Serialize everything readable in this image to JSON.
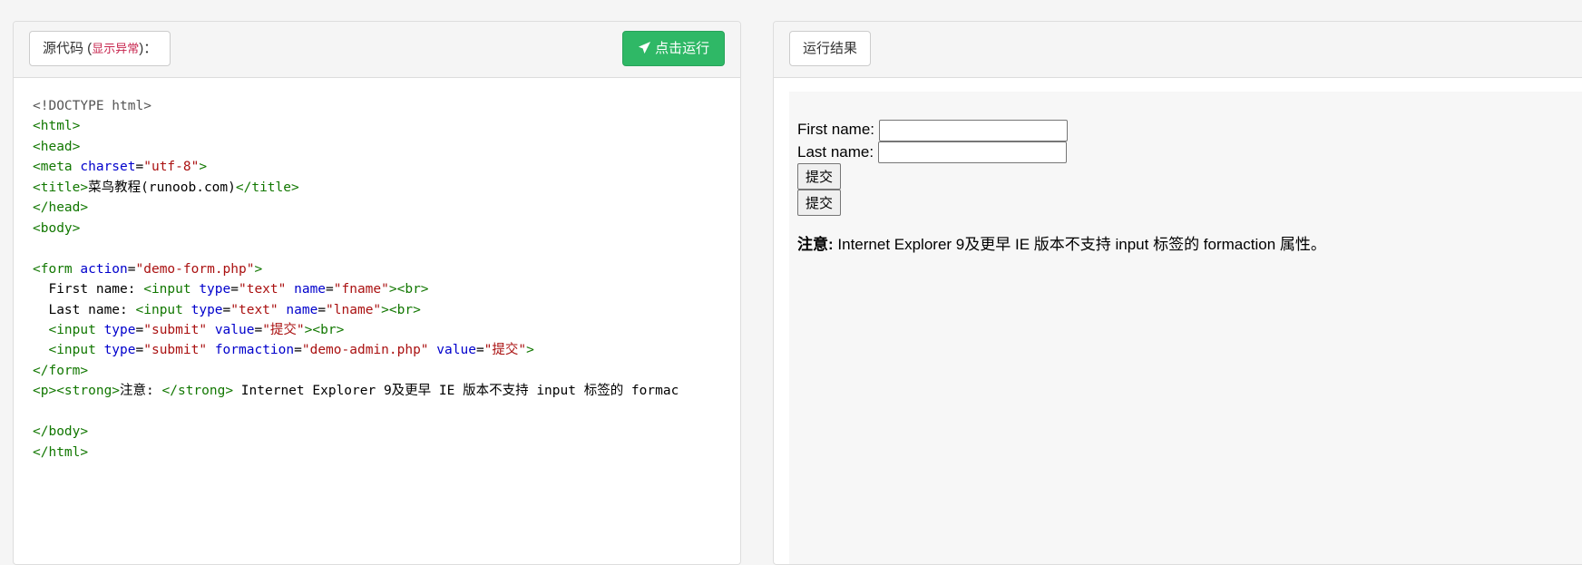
{
  "editor": {
    "label": "源代码",
    "error_link": "显示异常",
    "colon": "：",
    "run_button": "点击运行",
    "run_icon": "paper-plane-icon",
    "accent": "#2fb866"
  },
  "code_lines": [
    [
      {
        "t": "doc",
        "v": "<!DOCTYPE html>"
      }
    ],
    [
      {
        "t": "tag",
        "v": "<html>"
      }
    ],
    [
      {
        "t": "tag",
        "v": "<head>"
      }
    ],
    [
      {
        "t": "tag",
        "v": "<meta "
      },
      {
        "t": "attr",
        "v": "charset"
      },
      {
        "t": "text",
        "v": "="
      },
      {
        "t": "val",
        "v": "\"utf-8\""
      },
      {
        "t": "tag",
        "v": ">"
      }
    ],
    [
      {
        "t": "tag",
        "v": "<title>"
      },
      {
        "t": "text",
        "v": "菜鸟教程(runoob.com)"
      },
      {
        "t": "tag",
        "v": "</title>"
      }
    ],
    [
      {
        "t": "tag",
        "v": "</head>"
      }
    ],
    [
      {
        "t": "tag",
        "v": "<body>"
      }
    ],
    [],
    [
      {
        "t": "tag",
        "v": "<form "
      },
      {
        "t": "attr",
        "v": "action"
      },
      {
        "t": "text",
        "v": "="
      },
      {
        "t": "val",
        "v": "\"demo-form.php\""
      },
      {
        "t": "tag",
        "v": ">"
      }
    ],
    [
      {
        "t": "text",
        "v": "  First name: "
      },
      {
        "t": "tag",
        "v": "<input "
      },
      {
        "t": "attr",
        "v": "type"
      },
      {
        "t": "text",
        "v": "="
      },
      {
        "t": "val",
        "v": "\"text\""
      },
      {
        "t": "text",
        "v": " "
      },
      {
        "t": "attr",
        "v": "name"
      },
      {
        "t": "text",
        "v": "="
      },
      {
        "t": "val",
        "v": "\"fname\""
      },
      {
        "t": "tag",
        "v": "><br>"
      }
    ],
    [
      {
        "t": "text",
        "v": "  Last name: "
      },
      {
        "t": "tag",
        "v": "<input "
      },
      {
        "t": "attr",
        "v": "type"
      },
      {
        "t": "text",
        "v": "="
      },
      {
        "t": "val",
        "v": "\"text\""
      },
      {
        "t": "text",
        "v": " "
      },
      {
        "t": "attr",
        "v": "name"
      },
      {
        "t": "text",
        "v": "="
      },
      {
        "t": "val",
        "v": "\"lname\""
      },
      {
        "t": "tag",
        "v": "><br>"
      }
    ],
    [
      {
        "t": "text",
        "v": "  "
      },
      {
        "t": "tag",
        "v": "<input "
      },
      {
        "t": "attr",
        "v": "type"
      },
      {
        "t": "text",
        "v": "="
      },
      {
        "t": "val",
        "v": "\"submit\""
      },
      {
        "t": "text",
        "v": " "
      },
      {
        "t": "attr",
        "v": "value"
      },
      {
        "t": "text",
        "v": "="
      },
      {
        "t": "val",
        "v": "\"提交\""
      },
      {
        "t": "tag",
        "v": "><br>"
      }
    ],
    [
      {
        "t": "text",
        "v": "  "
      },
      {
        "t": "tag",
        "v": "<input "
      },
      {
        "t": "attr",
        "v": "type"
      },
      {
        "t": "text",
        "v": "="
      },
      {
        "t": "val",
        "v": "\"submit\""
      },
      {
        "t": "text",
        "v": " "
      },
      {
        "t": "attr",
        "v": "formaction"
      },
      {
        "t": "text",
        "v": "="
      },
      {
        "t": "val",
        "v": "\"demo-admin.php\""
      },
      {
        "t": "text",
        "v": " "
      },
      {
        "t": "attr",
        "v": "value"
      },
      {
        "t": "text",
        "v": "="
      },
      {
        "t": "val",
        "v": "\"提交\""
      },
      {
        "t": "tag",
        "v": ">"
      }
    ],
    [
      {
        "t": "tag",
        "v": "</form>"
      }
    ],
    [
      {
        "t": "tag",
        "v": "<p><strong>"
      },
      {
        "t": "text",
        "v": "注意: "
      },
      {
        "t": "tag",
        "v": "</strong>"
      },
      {
        "t": "text",
        "v": " Internet Explorer 9及更早 IE 版本不支持 input 标签的 formac"
      }
    ],
    [],
    [
      {
        "t": "tag",
        "v": "</body>"
      }
    ],
    [
      {
        "t": "tag",
        "v": "</html>"
      }
    ]
  ],
  "result": {
    "label": "运行结果",
    "first_name_label": "First name:",
    "first_name_value": "",
    "last_name_label": "Last name:",
    "last_name_value": "",
    "submit1": "提交",
    "submit2": "提交",
    "note_strong": "注意:",
    "note_text": " Internet Explorer 9及更早 IE 版本不支持 input 标签的 formaction 属性。"
  }
}
